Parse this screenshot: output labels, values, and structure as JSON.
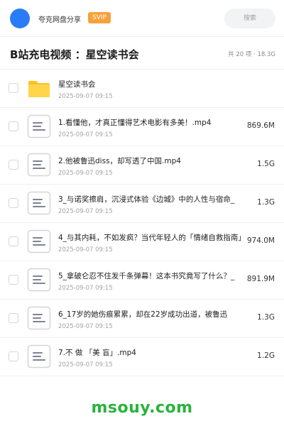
{
  "header": {
    "site_name": "夸克网盘分享",
    "badge": "SVIP",
    "search_placeholder": "搜索",
    "colors": {
      "avatar": "#2a7cf6",
      "badge": "#f7a13a"
    }
  },
  "folder": {
    "title": "B站充电视频 ：星空读书会",
    "summary": "共 20 项 · 18.3G"
  },
  "items": [
    {
      "type": "folder",
      "name": "星空读书会",
      "date": "2025-09-07 09:15",
      "size": ""
    },
    {
      "type": "file",
      "name": "1.看懂他，才真正懂得艺术电影有多美！.mp4",
      "date": "2025-09-07 09:15",
      "size": "869.6M"
    },
    {
      "type": "file",
      "name": "2.他被鲁迅diss，却写透了中国.mp4",
      "date": "2025-09-07 09:15",
      "size": "1.5G"
    },
    {
      "type": "file",
      "name": "3_与诺奖擦肩，沉浸式体验《边城》中的人性与宿命_",
      "date": "2025-09-07 09:15",
      "size": "1.3G"
    },
    {
      "type": "file",
      "name": "4_与其内耗，不如发疯？当代年轻人的「情绪自救指南」",
      "date": "2025-09-07 09:15",
      "size": "974.0M"
    },
    {
      "type": "file",
      "name": "5_拿破仑忍不住发千条弹幕！这本书究竟写了什么？_",
      "date": "2025-09-07 09:15",
      "size": "891.9M"
    },
    {
      "type": "file",
      "name": "6_17岁的她伤痕累累，却在22岁成功出道，被鲁迅",
      "date": "2025-09-07 09:15",
      "size": "1.3G"
    },
    {
      "type": "file",
      "name": "7.不 做 「美 盲」.mp4",
      "date": "2025-09-07 09:15",
      "size": "1.2G"
    }
  ],
  "icons": {
    "folder": "folder-icon",
    "file": "document-icon"
  },
  "watermark": "msouy.com"
}
